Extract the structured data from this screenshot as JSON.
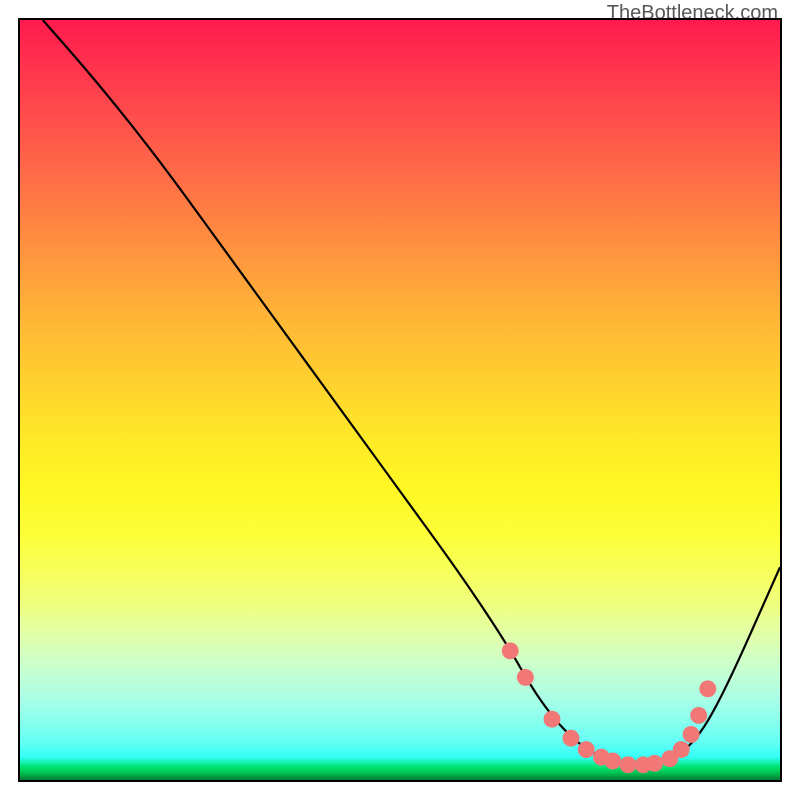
{
  "attribution": "TheBottleneck.com",
  "chart_data": {
    "type": "line",
    "title": "",
    "xlabel": "",
    "ylabel": "",
    "xlim": [
      0,
      100
    ],
    "ylim": [
      0,
      100
    ],
    "series": [
      {
        "name": "curve",
        "x": [
          3,
          10,
          18,
          26,
          34,
          42,
          50,
          58,
          64,
          68,
          72,
          76,
          80,
          84,
          88,
          92,
          100
        ],
        "y": [
          100,
          92,
          82,
          71,
          60,
          49,
          38,
          27,
          18,
          11,
          6,
          3,
          2,
          2,
          4,
          10,
          28
        ]
      }
    ],
    "beads": {
      "name": "highlight-points",
      "x": [
        64.5,
        66.5,
        70,
        72.5,
        74.5,
        76.5,
        78,
        80,
        82,
        83.5,
        85.5,
        87,
        88.3,
        89.3,
        90.5
      ],
      "y": [
        17,
        13.5,
        8,
        5.5,
        4,
        3,
        2.5,
        2,
        2,
        2.2,
        2.8,
        4,
        6,
        8.5,
        12
      ]
    },
    "gradient_stops": [
      {
        "pct": 0,
        "color": "#ff1a4d"
      },
      {
        "pct": 50,
        "color": "#ffe928"
      },
      {
        "pct": 80,
        "color": "#e4ffa0"
      },
      {
        "pct": 100,
        "color": "#007a33"
      }
    ]
  }
}
